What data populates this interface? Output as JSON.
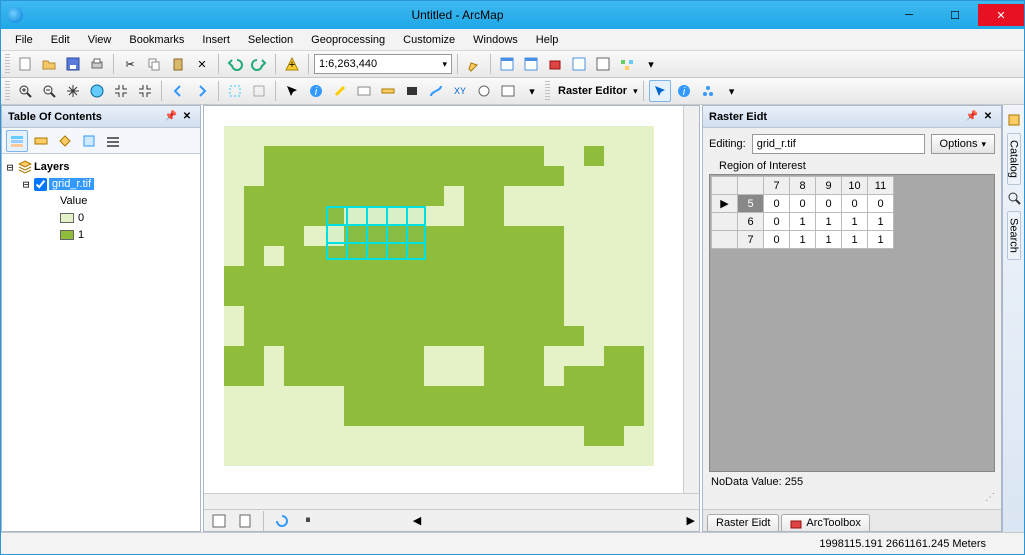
{
  "title": "Untitled - ArcMap",
  "menu": [
    "File",
    "Edit",
    "View",
    "Bookmarks",
    "Insert",
    "Selection",
    "Geoprocessing",
    "Customize",
    "Windows",
    "Help"
  ],
  "scale": "1:6,263,440",
  "raster_editor_label": "Raster Editor",
  "toc": {
    "title": "Table Of Contents",
    "layers_label": "Layers",
    "layer_name": "grid_r.tif",
    "value_label": "Value",
    "legend": [
      {
        "color": "#e5f2c8",
        "label": "0"
      },
      {
        "color": "#8fbc3a",
        "label": "1"
      }
    ]
  },
  "raster_panel": {
    "title": "Raster Eidt",
    "editing_label": "Editing:",
    "editing_value": "grid_r.tif",
    "options_label": "Options",
    "roi_label": "Region of Interest",
    "nodata_label": "NoData Value: 255",
    "cols": [
      "7",
      "8",
      "9",
      "10",
      "11"
    ],
    "rows": [
      {
        "h": "5",
        "sel": true,
        "v": [
          "0",
          "0",
          "0",
          "0",
          "0"
        ]
      },
      {
        "h": "6",
        "sel": false,
        "v": [
          "0",
          "1",
          "1",
          "1",
          "1"
        ]
      },
      {
        "h": "7",
        "sel": false,
        "v": [
          "0",
          "1",
          "1",
          "1",
          "1"
        ]
      }
    ]
  },
  "tabs": [
    "Raster Eidt",
    "ArcToolbox"
  ],
  "side_tabs": [
    "Catalog",
    "Search"
  ],
  "status_coords": "1998115.191 2661161.245 Meters",
  "chart_data": {
    "type": "table",
    "title": "Region of Interest raster cell values",
    "columns": [
      "7",
      "8",
      "9",
      "10",
      "11"
    ],
    "rows": [
      "5",
      "6",
      "7"
    ],
    "values": [
      [
        0,
        0,
        0,
        0,
        0
      ],
      [
        0,
        1,
        1,
        1,
        1
      ],
      [
        0,
        1,
        1,
        1,
        1
      ]
    ],
    "nodata_value": 255
  }
}
